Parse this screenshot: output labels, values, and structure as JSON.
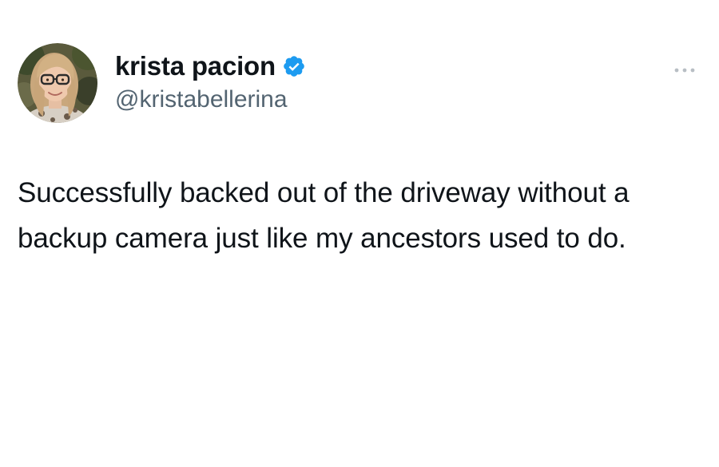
{
  "tweet": {
    "author": {
      "display_name": "krista pacion",
      "handle": "@kristabellerina",
      "verified": true,
      "verified_icon": "verified-badge-icon",
      "avatar": "profile-photo"
    },
    "text": "Successfully backed out of the driveway without a backup camera just like my ancestors used to do.",
    "more_icon": "more-options-icon"
  },
  "colors": {
    "background": "#ffffff",
    "text": "#0f1419",
    "secondary_text": "#536471",
    "verified_blue": "#1d9bf0",
    "more_dots": "#b8bec4"
  }
}
